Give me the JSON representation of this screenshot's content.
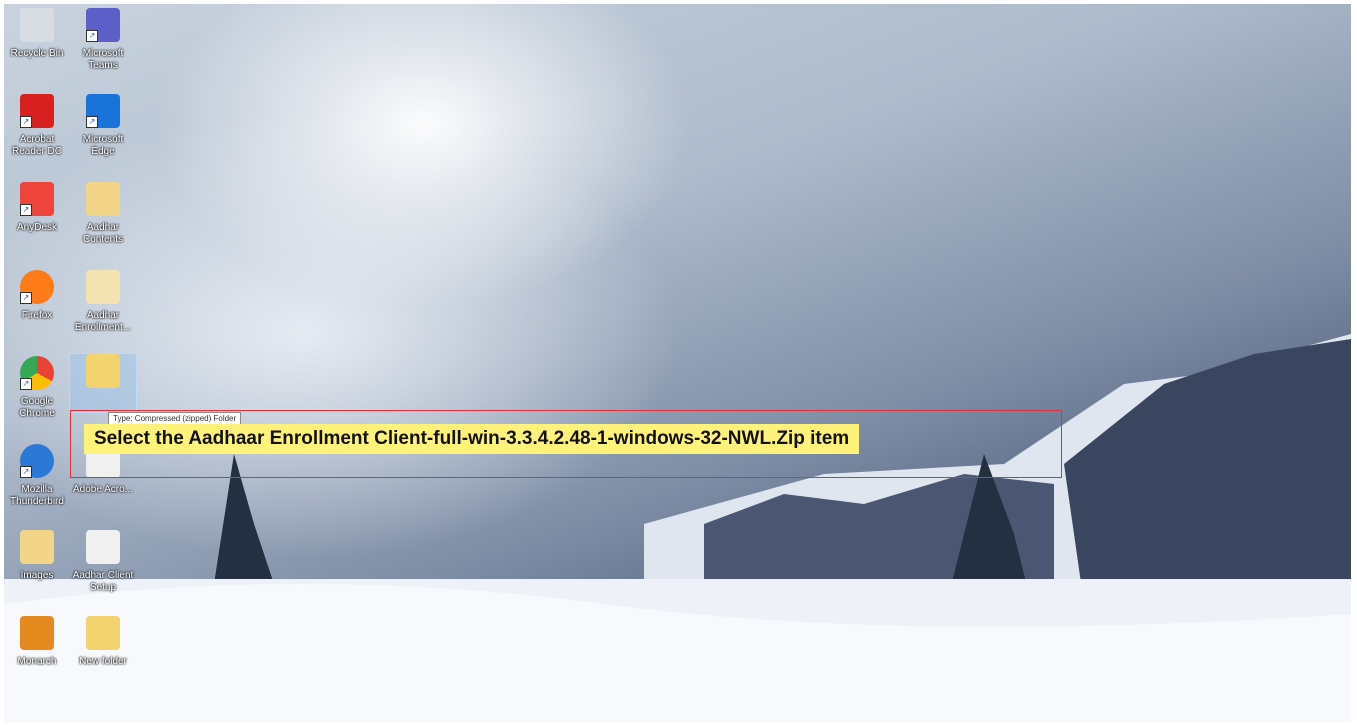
{
  "desktop_icons": [
    {
      "label": "Recycle Bin",
      "color": "#d8dde3"
    },
    {
      "label": "Microsoft Teams",
      "color": "#5b5fc7"
    },
    {
      "label": "Acrobat Reader DC",
      "color": "#d7201f"
    },
    {
      "label": "Microsoft Edge",
      "color": "#1a73d9"
    },
    {
      "label": "AnyDesk",
      "color": "#ef443b"
    },
    {
      "label": "Aadhar Contents",
      "color": "#f2d589"
    },
    {
      "label": "Firefox",
      "color": "#ff7a18"
    },
    {
      "label": "Aadhar Enrollment...",
      "color": "#f2e3b0"
    },
    {
      "label": "Google Chrome",
      "color": "#34a853"
    },
    {
      "label": "Aadhaar Enrollment Client-full-win-3.3.4.2.48-1-windows-32-NWL",
      "color": "#f3d36d"
    },
    {
      "label": "Mozilla Thunderbird",
      "color": "#2b78d6"
    },
    {
      "label": "Adobe Acro...",
      "color": "#f0f0f0"
    },
    {
      "label": "Images",
      "color": "#f2d589"
    },
    {
      "label": "Aadhar Client Setup",
      "color": "#f0f0f0"
    },
    {
      "label": "Monarch",
      "color": "#e58a1f"
    },
    {
      "label": "New folder",
      "color": "#f3d36d"
    }
  ],
  "tooltip": "Type: Compressed (zipped) Folder",
  "instruction": "Select the Aadhaar Enrollment Client-full-win-3.3.4.2.48-1-windows-32-NWL.Zip item",
  "colors": {
    "highlight_border": "#e0303a",
    "instruction_bg": "#fff27a"
  }
}
